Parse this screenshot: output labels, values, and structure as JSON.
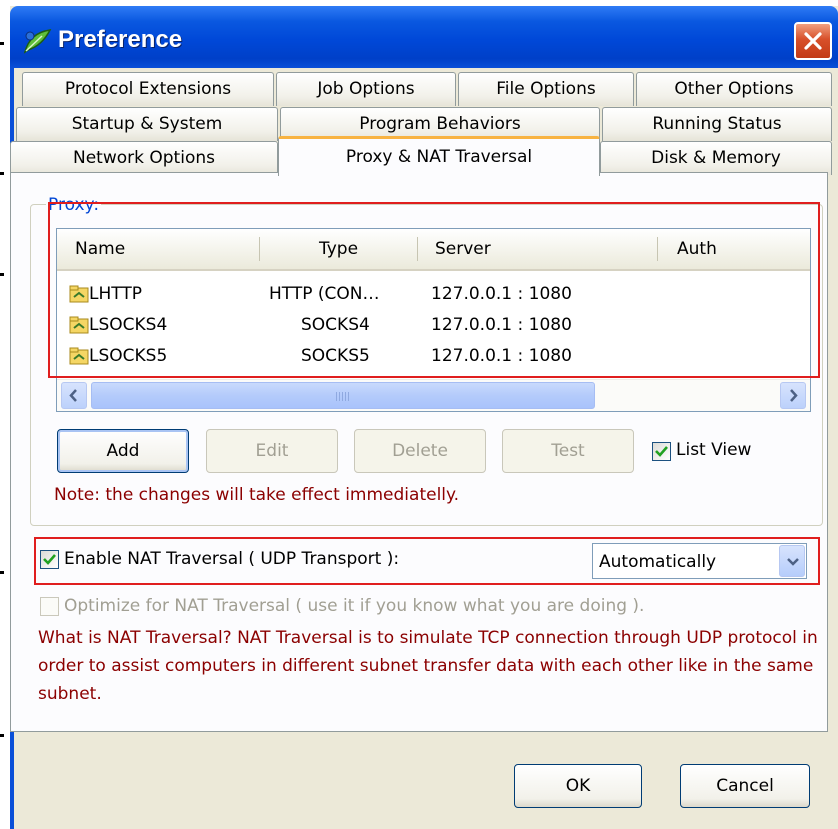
{
  "window": {
    "title": "Preference"
  },
  "tabs": {
    "row1": [
      "Protocol Extensions",
      "Job Options",
      "File Options",
      "Other Options"
    ],
    "row2": [
      "Startup & System",
      "Program Behaviors",
      "Running Status"
    ],
    "row3": [
      "Network Options",
      "Proxy & NAT Traversal",
      "Disk & Memory"
    ],
    "active": "Proxy & NAT Traversal"
  },
  "proxy": {
    "group_label": "Proxy:",
    "columns": [
      "Name",
      "Type",
      "Server",
      "Auth"
    ],
    "rows": [
      {
        "name": "LHTTP",
        "type": "HTTP (CON…",
        "server": "127.0.0.1 : 1080",
        "auth": ""
      },
      {
        "name": "LSOCKS4",
        "type": "SOCKS4",
        "server": "127.0.0.1 : 1080",
        "auth": ""
      },
      {
        "name": "LSOCKS5",
        "type": "SOCKS5",
        "server": "127.0.0.1 : 1080",
        "auth": ""
      }
    ],
    "buttons": {
      "add": "Add",
      "edit": "Edit",
      "delete": "Delete",
      "test": "Test"
    },
    "list_view": {
      "label": "List View",
      "checked": true
    },
    "note": "Note: the changes will take effect immediatelly."
  },
  "nat": {
    "enable_label": "Enable NAT Traversal ( UDP Transport ):",
    "enable_checked": true,
    "mode": "Automatically",
    "optimize_label": "Optimize for NAT Traversal ( use it if you know what you are doing ).",
    "optimize_checked": false,
    "description": "What is NAT Traversal? NAT Traversal is to simulate TCP connection through UDP protocol in order to assist computers in different subnet transfer data with each other like in the same subnet."
  },
  "dialog_buttons": {
    "ok": "OK",
    "cancel": "Cancel"
  },
  "colors": {
    "title_bar": "#0048d8",
    "group_label": "#0046d5",
    "note": "#8b0000",
    "highlight": "#e01e1e",
    "active_tab": "#f8b342"
  }
}
